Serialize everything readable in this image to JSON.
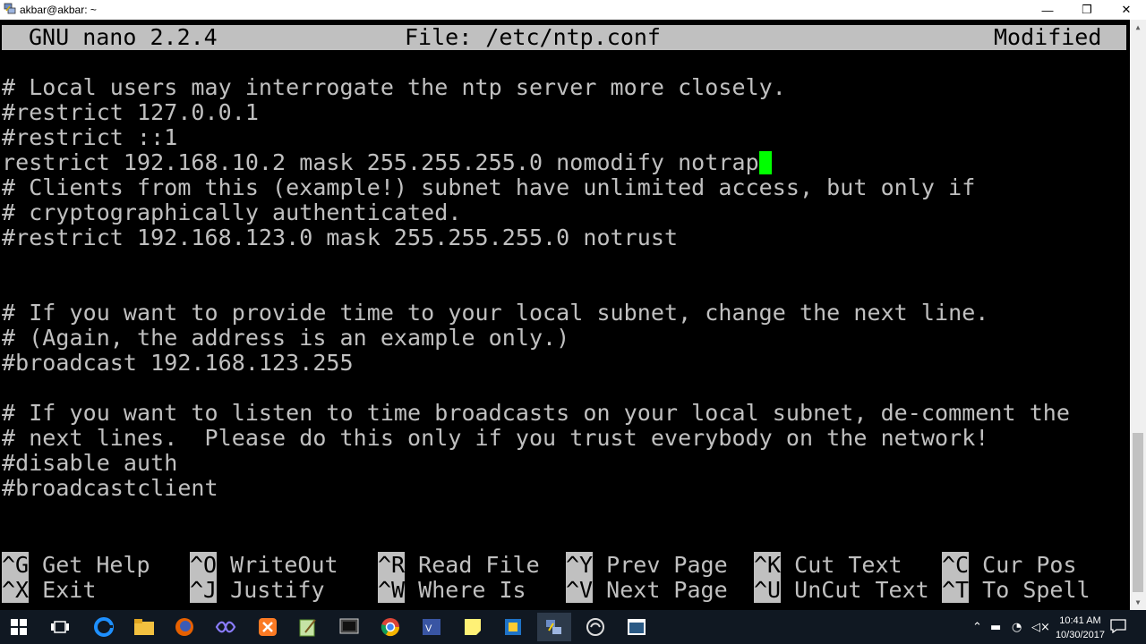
{
  "window": {
    "title": "akbar@akbar: ~",
    "minimize": "—",
    "restore": "❐",
    "close": "✕"
  },
  "nano": {
    "version": "GNU nano 2.2.4",
    "file": "File: /etc/ntp.conf",
    "status": "Modified"
  },
  "lines": [
    "# Local users may interrogate the ntp server more closely.",
    "#restrict 127.0.0.1",
    "#restrict ::1",
    "restrict 192.168.10.2 mask 255.255.255.0 nomodify notrap",
    "# Clients from this (example!) subnet have unlimited access, but only if",
    "# cryptographically authenticated.",
    "#restrict 192.168.123.0 mask 255.255.255.0 notrust",
    "",
    "",
    "# If you want to provide time to your local subnet, change the next line.",
    "# (Again, the address is an example only.)",
    "#broadcast 192.168.123.255",
    "",
    "# If you want to listen to time broadcasts on your local subnet, de-comment the",
    "# next lines.  Please do this only if you trust everybody on the network!",
    "#disable auth",
    "#broadcastclient"
  ],
  "shortcuts": [
    {
      "key": "^G",
      "label": "Get Help"
    },
    {
      "key": "^X",
      "label": "Exit"
    },
    {
      "key": "^O",
      "label": "WriteOut"
    },
    {
      "key": "^J",
      "label": "Justify"
    },
    {
      "key": "^R",
      "label": "Read File"
    },
    {
      "key": "^W",
      "label": "Where Is"
    },
    {
      "key": "^Y",
      "label": "Prev Page"
    },
    {
      "key": "^V",
      "label": "Next Page"
    },
    {
      "key": "^K",
      "label": "Cut Text"
    },
    {
      "key": "^U",
      "label": "UnCut Text"
    },
    {
      "key": "^C",
      "label": "Cur Pos"
    },
    {
      "key": "^T",
      "label": "To Spell"
    }
  ],
  "taskbar": {
    "clock_time": "10:41 AM",
    "clock_date": "10/30/2017",
    "apps": [
      "windows-start-icon",
      "task-view-icon",
      "edge-icon",
      "file-explorer-icon",
      "firefox-icon",
      "vs-icon",
      "xampp-icon",
      "notepadpp-icon",
      "putty-icon",
      "chrome-icon",
      "visio-icon",
      "sticky-notes-icon",
      "virtualbox-icon",
      "network-app-icon",
      "cygwin-icon",
      "terminal-app-icon"
    ]
  },
  "colors": {
    "cursor": "#00ff00",
    "terminal_bg": "#000000",
    "terminal_fg": "#c0c0c0",
    "header_bg": "#c0c0c0"
  }
}
